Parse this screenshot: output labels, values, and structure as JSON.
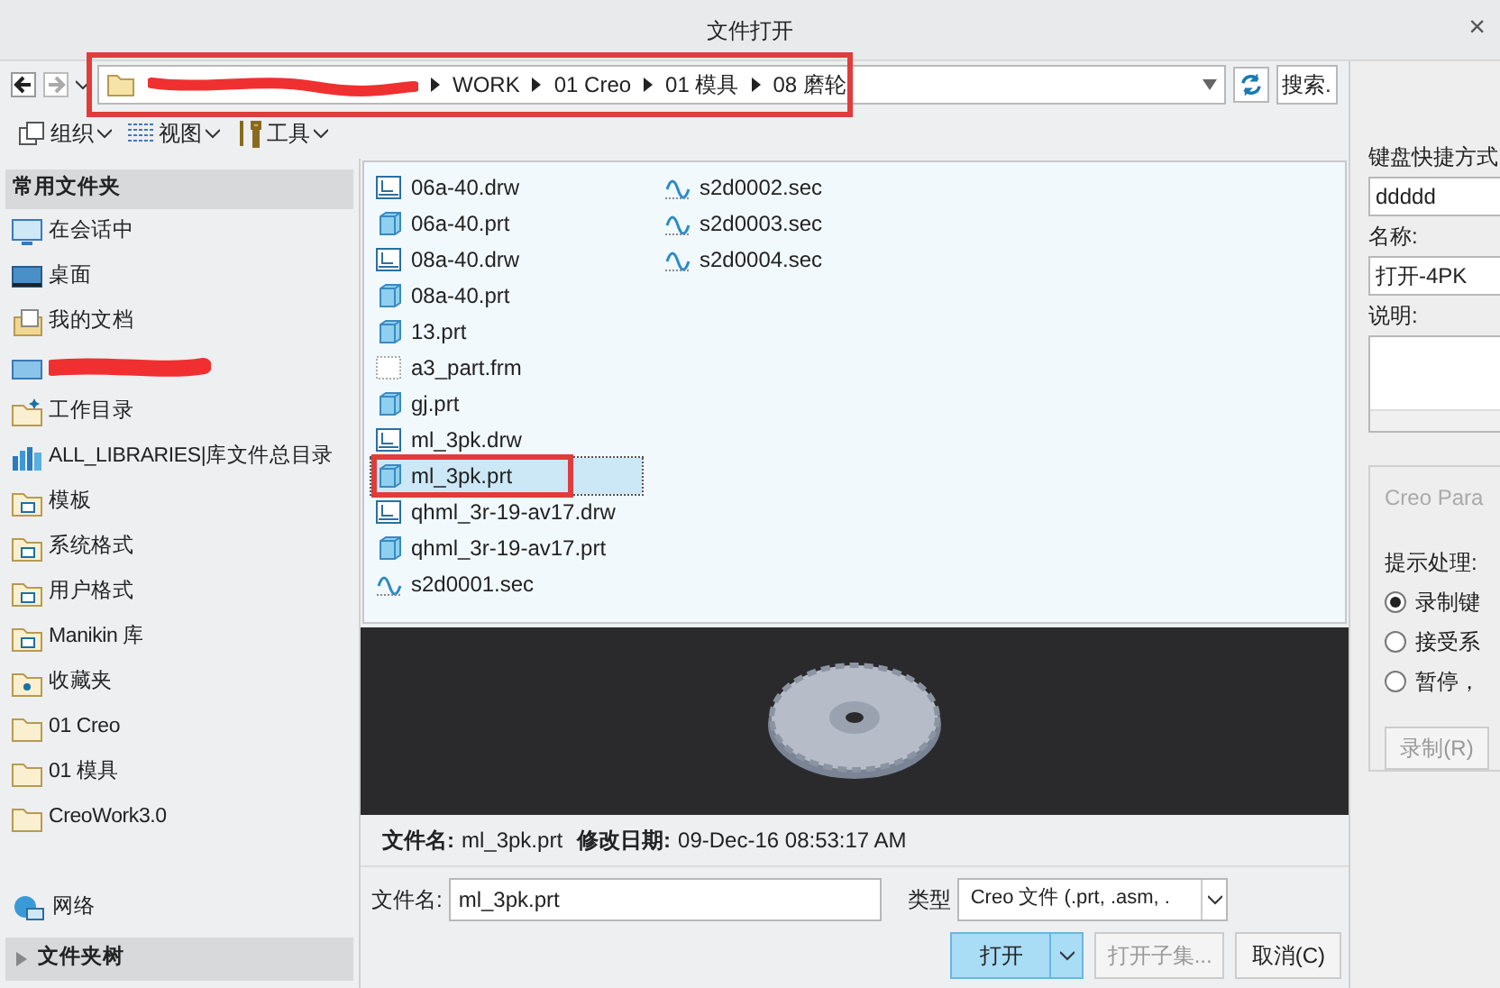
{
  "window": {
    "title": "文件打开",
    "close": "×"
  },
  "address": {
    "segments": [
      "WORK",
      "01 Creo",
      "01 模具",
      "08 磨轮"
    ],
    "search_placeholder": "搜索."
  },
  "toolbar": [
    "组织",
    "视图",
    "工具"
  ],
  "sidebar": {
    "header": "常用文件夹",
    "items": [
      {
        "kind": "monitor",
        "label": "在会话中"
      },
      {
        "kind": "desktop",
        "label": "桌面"
      },
      {
        "kind": "docs",
        "label": "我的文档"
      },
      {
        "kind": "redacted"
      },
      {
        "kind": "workdir",
        "label": "工作目录"
      },
      {
        "kind": "library",
        "label": "ALL_LIBRARIES|库文件总目录"
      },
      {
        "kind": "template",
        "label": "模板"
      },
      {
        "kind": "template",
        "label": "系统格式"
      },
      {
        "kind": "template",
        "label": "用户格式"
      },
      {
        "kind": "template",
        "label": "Manikin 库"
      },
      {
        "kind": "favorite",
        "label": "收藏夹"
      },
      {
        "kind": "folder",
        "label": "01 Creo"
      },
      {
        "kind": "folder",
        "label": "01 模具"
      },
      {
        "kind": "folder",
        "label": "CreoWork3.0"
      }
    ],
    "network": "网络",
    "tree": "文件夹树"
  },
  "files": [
    {
      "name": "06a-40.drw",
      "kind": "drw",
      "selected": false
    },
    {
      "name": "06a-40.prt",
      "kind": "prt",
      "selected": false
    },
    {
      "name": "08a-40.drw",
      "kind": "drw",
      "selected": false
    },
    {
      "name": "08a-40.prt",
      "kind": "prt",
      "selected": false
    },
    {
      "name": "13.prt",
      "kind": "prt",
      "selected": false
    },
    {
      "name": "a3_part.frm",
      "kind": "frm",
      "selected": false
    },
    {
      "name": "gj.prt",
      "kind": "prt",
      "selected": false
    },
    {
      "name": "ml_3pk.drw",
      "kind": "drw",
      "selected": false
    },
    {
      "name": "ml_3pk.prt",
      "kind": "prt",
      "selected": true
    },
    {
      "name": "qhml_3r-19-av17.drw",
      "kind": "drw",
      "selected": false
    },
    {
      "name": "qhml_3r-19-av17.prt",
      "kind": "prt",
      "selected": false
    },
    {
      "name": "s2d0001.sec",
      "kind": "sec",
      "selected": false
    },
    {
      "name": "s2d0002.sec",
      "kind": "sec",
      "selected": false
    },
    {
      "name": "s2d0003.sec",
      "kind": "sec",
      "selected": false
    },
    {
      "name": "s2d0004.sec",
      "kind": "sec",
      "selected": false
    }
  ],
  "info": {
    "name_label": "文件名:",
    "name": "ml_3pk.prt",
    "date_label": "修改日期:",
    "date": "09-Dec-16 08:53:17 AM"
  },
  "filename_field": {
    "label": "文件名:",
    "value": "ml_3pk.prt"
  },
  "type_field": {
    "label": "类型",
    "value": "Creo 文件 (.prt, .asm, ."
  },
  "buttons": {
    "open": "打开",
    "open_subset": "打开子集...",
    "cancel": "取消(C)"
  },
  "side_dialog": {
    "shortcut_label": "键盘快捷方式",
    "shortcut": "ddddd",
    "name_label": "名称:",
    "name": "打开-4PK",
    "desc_label": "说明:",
    "group_title": "Creo Para",
    "prompt_label": "提示处理:",
    "options": [
      {
        "label": "录制键",
        "selected": true
      },
      {
        "label": "接受系",
        "selected": false
      },
      {
        "label": "暂停，",
        "selected": false
      }
    ],
    "record": "录制(R)"
  }
}
